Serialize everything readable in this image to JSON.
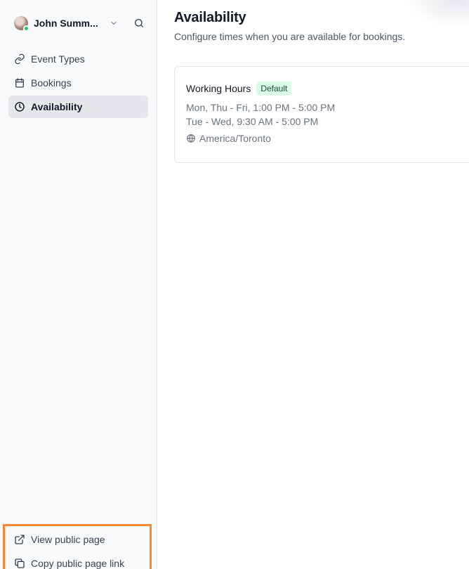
{
  "user": {
    "name": "John Summ..."
  },
  "nav": {
    "items": [
      {
        "label": "Event Types",
        "icon": "link-icon"
      },
      {
        "label": "Bookings",
        "icon": "calendar-icon"
      },
      {
        "label": "Availability",
        "icon": "clock-icon",
        "active": true
      }
    ],
    "bottom": [
      {
        "label": "View public page",
        "icon": "external-link-icon"
      },
      {
        "label": "Copy public page link",
        "icon": "copy-icon"
      }
    ]
  },
  "page": {
    "title": "Availability",
    "subtitle": "Configure times when you are available for bookings."
  },
  "schedule": {
    "name": "Working Hours",
    "badge": "Default",
    "lines": [
      "Mon, Thu - Fri, 1:00 PM - 5:00 PM",
      "Tue - Wed, 9:30 AM - 5:00 PM"
    ],
    "timezone": "America/Toronto"
  },
  "colors": {
    "highlight": "#f58a32",
    "active_bg": "#e5e7eb",
    "badge_bg": "#dcfce7",
    "online": "#22c55e"
  }
}
